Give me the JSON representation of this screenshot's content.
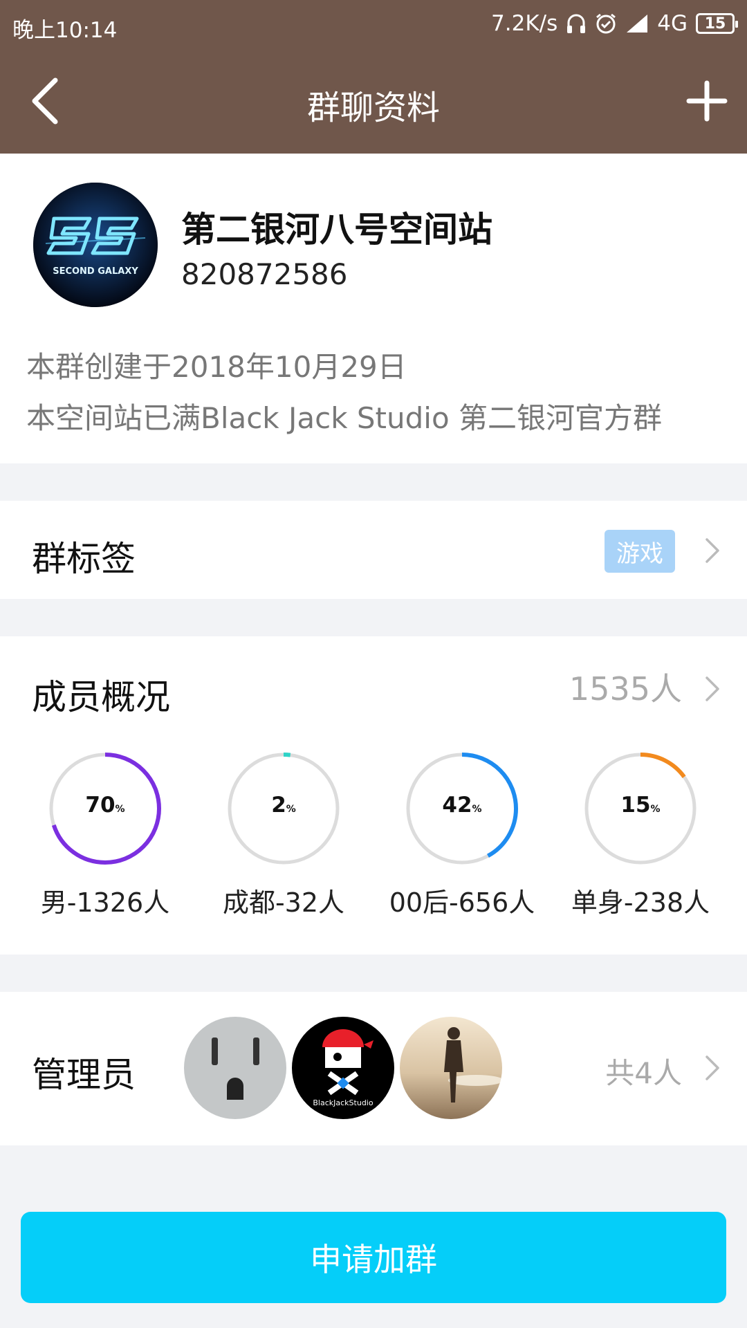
{
  "status_bar": {
    "time": "晚上10:14",
    "network_speed": "7.2K/s",
    "network_type": "4G",
    "battery": "15"
  },
  "navbar": {
    "title": "群聊资料",
    "back_icon": "chevron-left-icon",
    "add_icon": "plus-icon"
  },
  "group": {
    "name": "第二银河八号空间站",
    "id": "820872586",
    "avatar_text": "SECOND GALAXY",
    "created": "本群创建于2018年10月29日",
    "description": "本空间站已满Black Jack Studio 第二银河官方群"
  },
  "tags": {
    "label": "群标签",
    "chip": "游戏"
  },
  "members": {
    "label": "成员概况",
    "count": "1535人",
    "stats": [
      {
        "percent": 70,
        "value": "70",
        "unit": "%",
        "caption": "男-1326人",
        "color": "#7b2fe0"
      },
      {
        "percent": 2,
        "value": "2",
        "unit": "%",
        "caption": "成都-32人",
        "color": "#2fd3c7"
      },
      {
        "percent": 42,
        "value": "42",
        "unit": "%",
        "caption": "00后-656人",
        "color": "#1e8cf0"
      },
      {
        "percent": 15,
        "value": "15",
        "unit": "%",
        "caption": "单身-238人",
        "color": "#f28a1e"
      }
    ]
  },
  "admins": {
    "label": "管理员",
    "total": "共4人",
    "avatar2_text": "BlackJackStudio"
  },
  "join_button": "申请加群"
}
